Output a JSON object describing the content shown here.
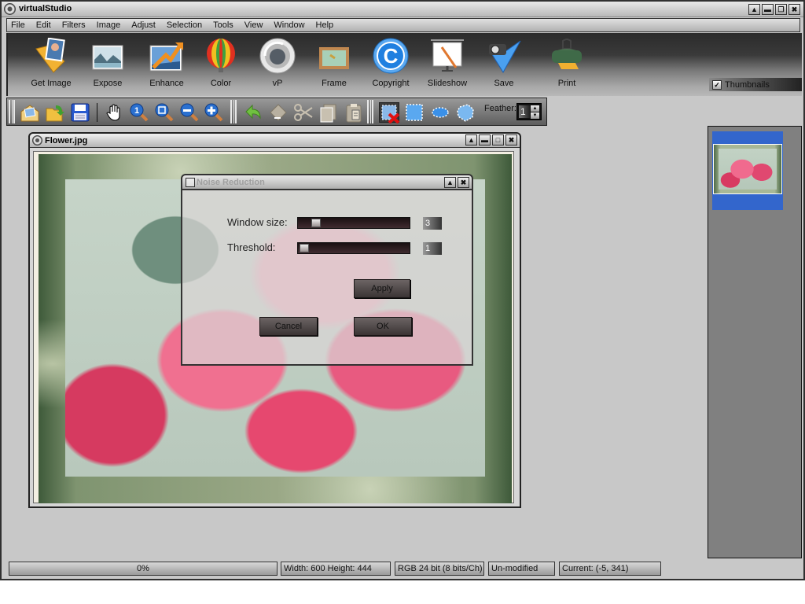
{
  "app": {
    "title": "virtualStudio",
    "window_buttons": [
      "▲",
      "▬",
      "❐",
      "✖"
    ]
  },
  "menu": [
    "File",
    "Edit",
    "Filters",
    "Image",
    "Adjust",
    "Selection",
    "Tools",
    "View",
    "Window",
    "Help"
  ],
  "big_toolbar": [
    {
      "label": "Get Image",
      "icon": "folder-photo-icon"
    },
    {
      "label": "Expose",
      "icon": "landscape-icon"
    },
    {
      "label": "Enhance",
      "icon": "enhance-arrow-icon"
    },
    {
      "label": "Color",
      "icon": "balloon-icon"
    },
    {
      "label": "vP",
      "icon": "vp-logo-icon"
    },
    {
      "label": "Frame",
      "icon": "frame-icon"
    },
    {
      "label": "Copyright",
      "icon": "copyright-icon"
    },
    {
      "label": "Slideshow",
      "icon": "slideshow-icon"
    },
    {
      "label": "Save",
      "icon": "save-camera-icon"
    },
    {
      "label": "Print",
      "icon": "printer-icon"
    }
  ],
  "thumbnails_toggle": {
    "label": "Thumbnails",
    "checked": true
  },
  "small_toolbar": {
    "groups": [
      [
        "open-mail-icon",
        "open-folder-icon",
        "floppy-save-icon"
      ],
      [
        "hand-pan-icon",
        "zoom-actual-icon",
        "zoom-fit-icon",
        "zoom-out-icon",
        "zoom-in-icon"
      ],
      [
        "undo-icon",
        "redo-icon",
        "cut-icon",
        "copy-icon",
        "paste-icon"
      ],
      [
        "deselect-icon",
        "rect-select-icon",
        "ellipse-select-icon",
        "lasso-select-icon"
      ]
    ],
    "feather_label": "Feather:",
    "feather_value": "1"
  },
  "image_window": {
    "title": "Flower.jpg",
    "buttons": [
      "▲",
      "▬",
      "□",
      "✖"
    ]
  },
  "dialog": {
    "title": "Noise Reduction",
    "buttons": [
      "▲",
      "✖"
    ],
    "window_size_label": "Window size:",
    "window_size_value": "3",
    "window_size_fraction": 0.12,
    "threshold_label": "Threshold:",
    "threshold_value": "1",
    "threshold_fraction": 0.0,
    "apply_label": "Apply",
    "cancel_label": "Cancel",
    "ok_label": "OK"
  },
  "status": {
    "progress": "0%",
    "dimensions": "Width: 600  Height: 444",
    "color_mode": "RGB 24 bit (8 bits/Ch)",
    "modified": "Un-modified",
    "cursor": "Current: (-5, 341)"
  },
  "colors": {
    "thumbnail_selection": "#3366cc",
    "workspace_bg": "#c8c8c8",
    "thumb_panel_bg": "#808080"
  }
}
